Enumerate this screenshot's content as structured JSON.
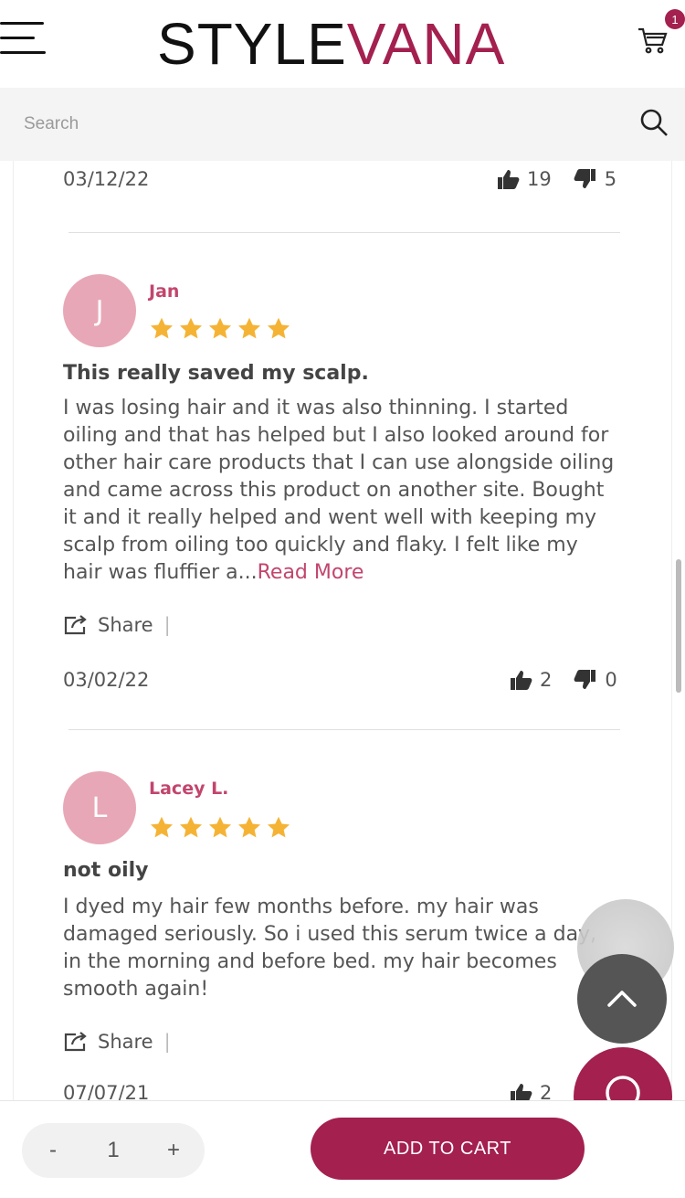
{
  "brand": {
    "name_part1": "STYLE",
    "name_part2": "VANA",
    "accent": "#a3204f"
  },
  "header": {
    "cart_count": "1"
  },
  "search": {
    "placeholder": "Search"
  },
  "prev_review": {
    "date": "03/12/22",
    "helpful": "19",
    "not_helpful": "5"
  },
  "reviews": [
    {
      "initial": "J",
      "name": "Jan",
      "rating": 5,
      "title": "This really saved my scalp.",
      "body": "I was losing hair and it was also thinning. I started oiling and that has helped but I also looked around for other hair care products that I can use alongside oiling and came across this product on another site. Bought it and it really helped and went well with keeping my scalp from oiling too quickly and flaky. I felt like my hair was fluffier a...",
      "read_more": "Read More",
      "share": "Share",
      "date": "03/02/22",
      "helpful": "2",
      "not_helpful": "0"
    },
    {
      "initial": "L",
      "name": "Lacey L.",
      "rating": 5,
      "title": "not oily",
      "body": "I dyed my hair few months before. my hair was damaged seriously. So i used this serum twice a day, in the morning and before bed. my hair becomes smooth again!",
      "share": "Share",
      "date": "07/07/21",
      "helpful": "2"
    }
  ],
  "bottom_bar": {
    "qty_minus": "-",
    "qty_value": "1",
    "qty_plus": "+",
    "add_to_cart": "ADD TO CART"
  },
  "colors": {
    "star": "#f5b335",
    "avatar": "#e8a7b6",
    "reviewer_name": "#c2456d"
  }
}
